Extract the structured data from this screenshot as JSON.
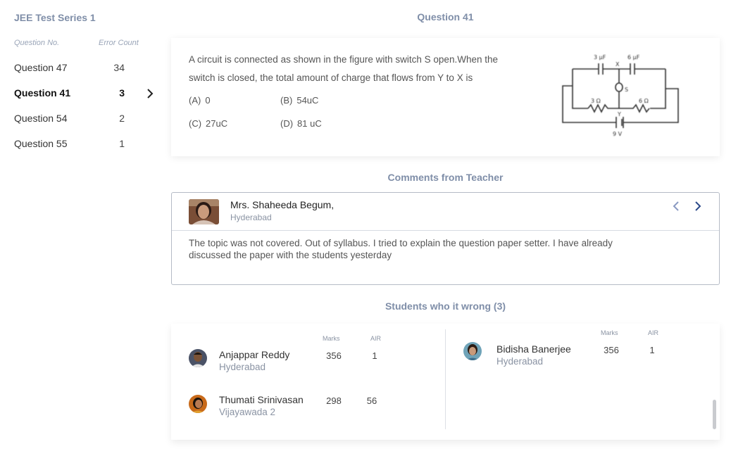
{
  "sidebar": {
    "title": "JEE Test Series 1",
    "col_question": "Question No.",
    "col_error": "Error Count",
    "items": [
      {
        "label": "Question 47",
        "count": "34"
      },
      {
        "label": "Question 41",
        "count": "3"
      },
      {
        "label": "Question 54",
        "count": "2"
      },
      {
        "label": "Question 55",
        "count": "1"
      }
    ]
  },
  "question": {
    "title": "Question 41",
    "text": "A circuit is connected as shown in the figure with switch S open.When the switch is closed, the total amount of charge that flows from Y to X is",
    "options": [
      {
        "tag": "(A)",
        "value": "0"
      },
      {
        "tag": "(B)",
        "value": "54uC"
      },
      {
        "tag": "(C)",
        "value": "27uC"
      },
      {
        "tag": "(D)",
        "value": "81 uC"
      }
    ],
    "figure_labels": {
      "c1": "3 μF",
      "c2": "6 μF",
      "x": "X",
      "s": "S",
      "r1": "3 Ω",
      "r2": "6 Ω",
      "y": "Y",
      "v": "9 V"
    }
  },
  "comments": {
    "title": "Comments from Teacher",
    "teacher_name": "Mrs. Shaheeda Begum,",
    "teacher_city": "Hyderabad",
    "text": "The  topic was not covered. Out of syllabus. I tried to explain the question paper setter. I have already discussed the paper with the students yesterday"
  },
  "students": {
    "title": "Students who it wrong (3)",
    "marks_label": "Marks",
    "air_label": "AIR",
    "list": [
      {
        "name": "Anjappar Reddy",
        "city": "Hyderabad",
        "marks": "356",
        "air": "1"
      },
      {
        "name": "Thumati Srinivasan",
        "city": "Vijayawada 2",
        "marks": "298",
        "air": "56"
      },
      {
        "name": "Bidisha Banerjee",
        "city": "Hyderabad",
        "marks": "356",
        "air": "1"
      }
    ]
  },
  "colors": {
    "accent": "#7f8ea8",
    "nav_active": "#2c4a8a"
  }
}
